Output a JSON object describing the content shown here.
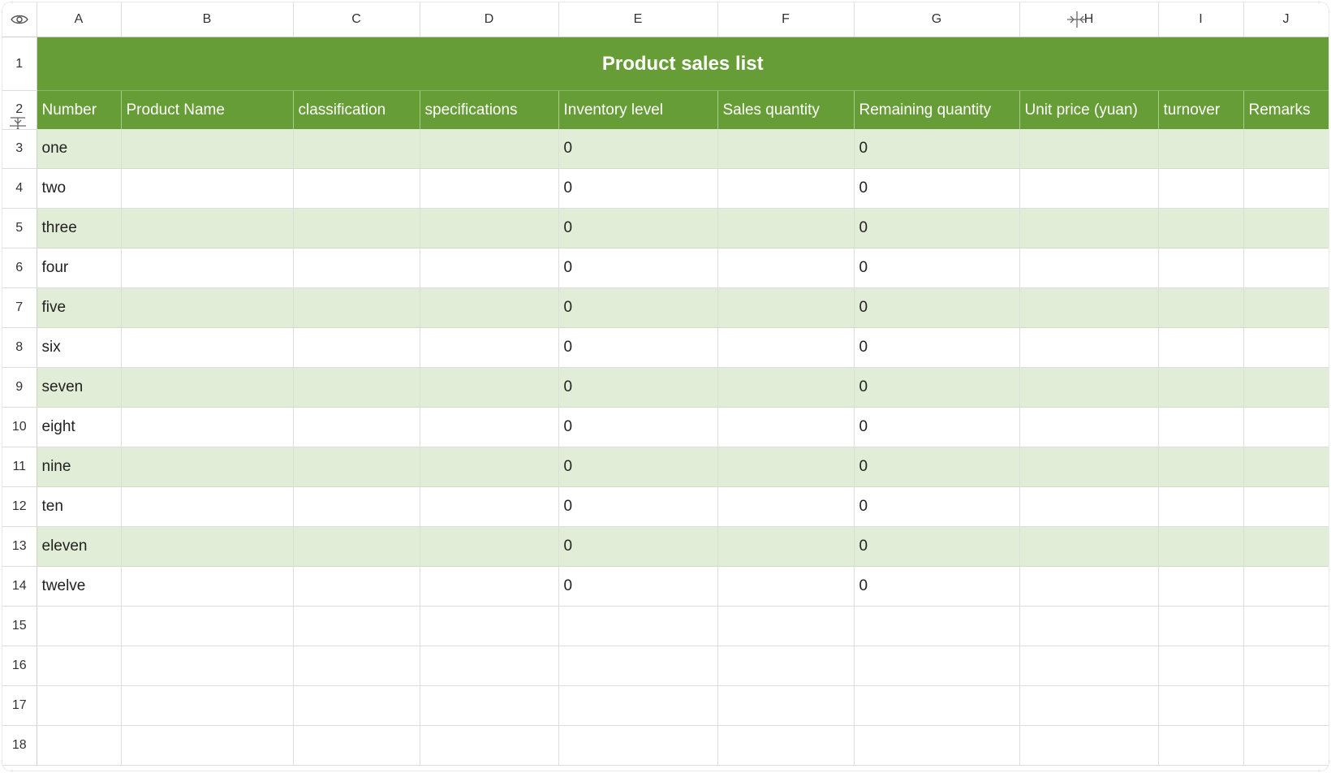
{
  "columns": [
    "A",
    "B",
    "C",
    "D",
    "E",
    "F",
    "G",
    "H",
    "I",
    "J"
  ],
  "rows": [
    "1",
    "2",
    "3",
    "4",
    "5",
    "6",
    "7",
    "8",
    "9",
    "10",
    "11",
    "12",
    "13",
    "14",
    "15",
    "16",
    "17",
    "18"
  ],
  "title": "Product sales list",
  "headers": [
    "Number",
    "Product Name",
    "classification",
    "specifications",
    "Inventory level",
    "Sales quantity",
    "Remaining quantity",
    "Unit price (yuan)",
    "turnover",
    "Remarks"
  ],
  "data_rows": [
    [
      "one",
      "",
      "",
      "",
      "0",
      "",
      "0",
      "",
      "",
      ""
    ],
    [
      "two",
      "",
      "",
      "",
      "0",
      "",
      "0",
      "",
      "",
      ""
    ],
    [
      "three",
      "",
      "",
      "",
      "0",
      "",
      "0",
      "",
      "",
      ""
    ],
    [
      "four",
      "",
      "",
      "",
      "0",
      "",
      "0",
      "",
      "",
      ""
    ],
    [
      "five",
      "",
      "",
      "",
      "0",
      "",
      "0",
      "",
      "",
      ""
    ],
    [
      "six",
      "",
      "",
      "",
      "0",
      "",
      "0",
      "",
      "",
      ""
    ],
    [
      "seven",
      "",
      "",
      "",
      "0",
      "",
      "0",
      "",
      "",
      ""
    ],
    [
      "eight",
      "",
      "",
      "",
      "0",
      "",
      "0",
      "",
      "",
      ""
    ],
    [
      "nine",
      "",
      "",
      "",
      "0",
      "",
      "0",
      "",
      "",
      ""
    ],
    [
      "ten",
      "",
      "",
      "",
      "0",
      "",
      "0",
      "",
      "",
      ""
    ],
    [
      "eleven",
      "",
      "",
      "",
      "0",
      "",
      "0",
      "",
      "",
      ""
    ],
    [
      "twelve",
      "",
      "",
      "",
      "0",
      "",
      "0",
      "",
      "",
      ""
    ],
    [
      "",
      "",
      "",
      "",
      "",
      "",
      "",
      "",
      "",
      ""
    ],
    [
      "",
      "",
      "",
      "",
      "",
      "",
      "",
      "",
      "",
      ""
    ],
    [
      "",
      "",
      "",
      "",
      "",
      "",
      "",
      "",
      "",
      ""
    ],
    [
      "",
      "",
      "",
      "",
      "",
      "",
      "",
      "",
      "",
      ""
    ]
  ],
  "icons": {
    "corner": "eye-icon",
    "column_resize": "column-resize-icon",
    "row_resize": "row-resize-icon"
  },
  "colors": {
    "header_green": "#679d36",
    "band_green": "#e1edd6",
    "header_text": "#ffffff"
  }
}
